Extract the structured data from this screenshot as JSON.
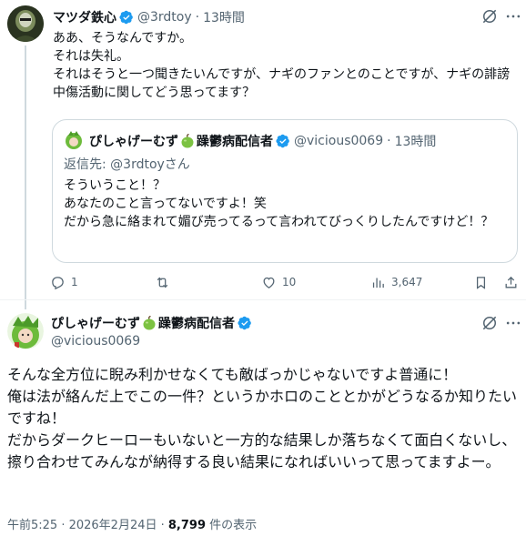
{
  "colors": {
    "verified": "#1d9bf0",
    "text": "#0f1419",
    "secondary": "#536471",
    "border": "#cfd9de"
  },
  "tweet1": {
    "display_name": "マツダ鉄心",
    "handle": "@3rdtoy",
    "time": "13時間",
    "text": "ああ、そうなんですか。\nそれは失礼。\nそれはそうと一つ聞きたいんですが、ナギのファンとのことですが、ナギの誹謗中傷活動に関してどう思ってます？",
    "quote": {
      "name_prefix": "ぴしゃげーむず",
      "name_suffix": "躁鬱病配信者",
      "handle": "@vicious0069",
      "time": "13時間",
      "reply_to": "返信先: @3rdtoyさん",
      "text": "そういうこと！？\nあなたのこと言ってないですよ！笑\nだから急に絡まれて媚び売ってるって言われてびっくりしたんですけど！？"
    },
    "actions": {
      "replies": "1",
      "reposts": "",
      "likes": "10",
      "views": "3,647"
    }
  },
  "tweet2": {
    "name_prefix": "ぴしゃげーむず",
    "name_suffix": "躁鬱病配信者",
    "handle": "@vicious0069",
    "text": "そんな全方位に睨み利かせなくても敵ばっかじゃないですよ普通に！\n俺は法が絡んだ上でこの一件？というかホロのこととかがどうなるか知りたいですね！\nだからダークヒーローもいないと一方的な結果しか落ちなくて面白くないし、擦り合わせてみんなが納得する良い結果になればいいって思ってますよー。",
    "timestamp": "午前5:25 · 2026年2月24日 · ",
    "view_count": "8,799",
    "view_suffix": " 件の表示"
  },
  "icons": [
    "verified-badge-icon",
    "apple-emoji-icon",
    "grok-icon",
    "more-icon",
    "reply-icon",
    "repost-icon",
    "like-icon",
    "views-icon",
    "bookmark-icon",
    "share-icon"
  ]
}
